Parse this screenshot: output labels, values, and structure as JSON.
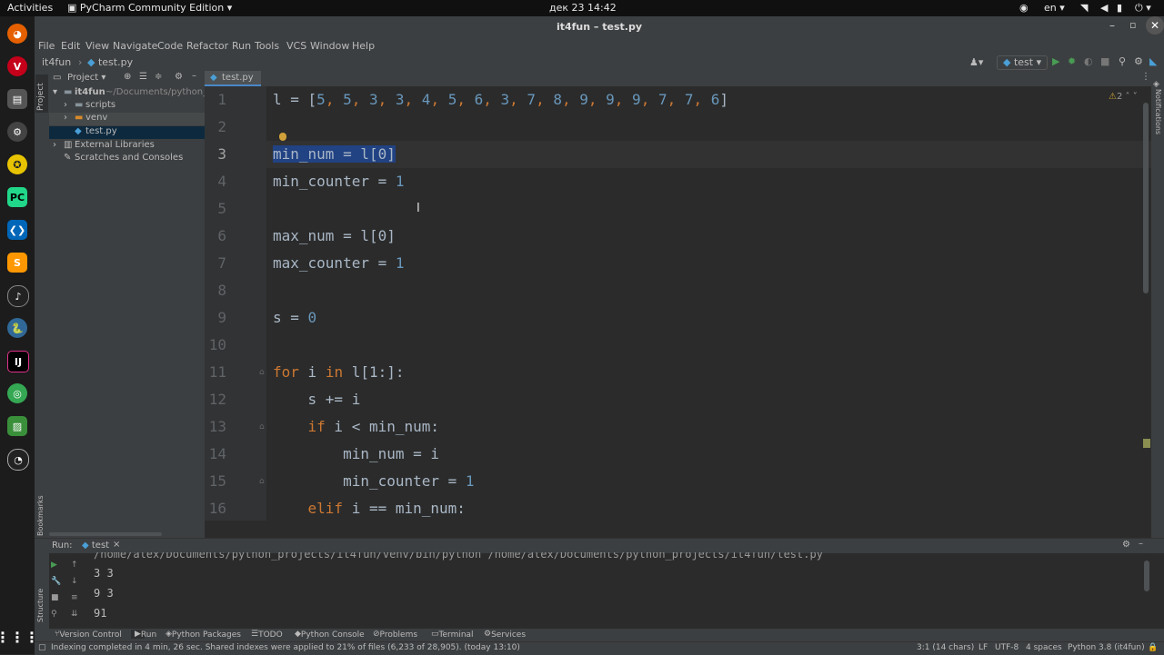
{
  "topbar": {
    "activities": "Activities",
    "app_menu": "PyCharm Community Edition",
    "datetime": "дек 23  14:42",
    "lang": "en"
  },
  "window": {
    "title": "it4fun – test.py"
  },
  "menu": [
    "File",
    "Edit",
    "View",
    "Navigate",
    "Code",
    "Refactor",
    "Run",
    "Tools",
    "VCS",
    "Window",
    "Help"
  ],
  "breadcrumb": {
    "project": "it4fun",
    "file": "test.py"
  },
  "run_config": "test",
  "project_panel": {
    "title": "Project",
    "side_label": "Project",
    "root": "it4fun",
    "root_path": "~/Documents/python_p",
    "items": [
      "scripts",
      "venv",
      "test.py",
      "External Libraries",
      "Scratches and Consoles"
    ]
  },
  "editor": {
    "tab": "test.py",
    "warnings": "2",
    "line_numbers": [
      "1",
      "2",
      "3",
      "4",
      "5",
      "6",
      "7",
      "8",
      "9",
      "10",
      "11",
      "12",
      "13",
      "14",
      "15",
      "16"
    ],
    "code": {
      "l1": {
        "a": "l = [",
        "nums": [
          "5",
          "5",
          "3",
          "3",
          "4",
          "5",
          "6",
          "3",
          "7",
          "8",
          "9",
          "9",
          "9",
          "7",
          "7",
          "6"
        ],
        "b": "]"
      },
      "l3": "min_num = l[0]",
      "l4a": "min_counter = ",
      "l4n": "1",
      "l6a": "max_num = l[0]",
      "l7a": "max_counter = ",
      "l7n": "1",
      "l9a": "s = ",
      "l9n": "0",
      "l11": {
        "kw1": "for",
        "a": " i ",
        "kw2": "in",
        "b": " l[1:]:"
      },
      "l12": "    s += i",
      "l13": {
        "kw": "if",
        "a": " i < min_num:"
      },
      "l14": "        min_num = i",
      "l15a": "        min_counter = ",
      "l15n": "1",
      "l16": {
        "kw": "elif",
        "a": " i == min_num:"
      }
    }
  },
  "run": {
    "label": "Run:",
    "tab": "test",
    "command": "/home/alex/Documents/python_projects/it4fun/venv/bin/python /home/alex/Documents/python_projects/it4fun/test.py",
    "output": [
      "3 3",
      "9 3",
      "91"
    ]
  },
  "side_labels": {
    "bookmarks": "Bookmarks",
    "structure": "Structure",
    "notifications": "Notifications"
  },
  "tool_windows": [
    "Version Control",
    "Run",
    "Python Packages",
    "TODO",
    "Python Console",
    "Problems",
    "Terminal",
    "Services"
  ],
  "status": {
    "message": "Indexing completed in 4 min, 26 sec. Shared indexes were applied to 21% of files (6,233 of 28,905). (today 13:10)",
    "position": "3:1 (14 chars)",
    "line_sep": "LF",
    "encoding": "UTF-8",
    "indent": "4 spaces",
    "interpreter": "Python 3.8 (it4fun)"
  }
}
